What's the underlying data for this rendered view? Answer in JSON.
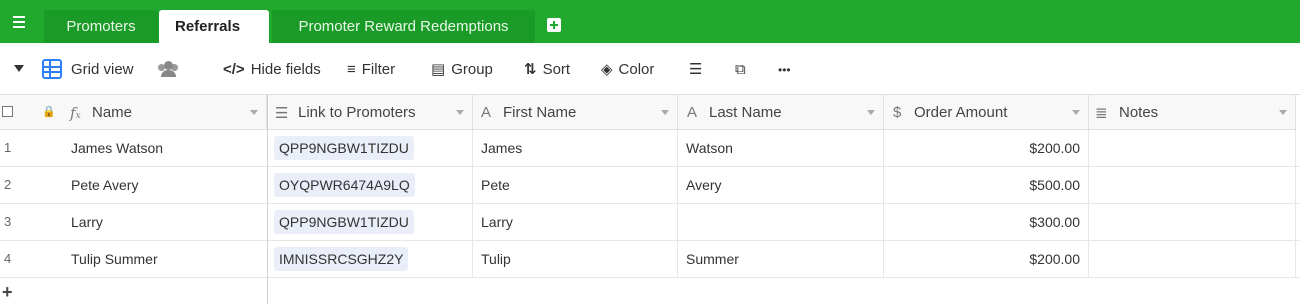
{
  "tabs": [
    {
      "label": "Promoters",
      "active": false
    },
    {
      "label": "Referrals",
      "active": true
    },
    {
      "label": "Promoter Reward Redemptions",
      "active": false
    }
  ],
  "toolbar": {
    "view_name": "Grid view",
    "hide_fields": "Hide fields",
    "filter": "Filter",
    "group": "Group",
    "sort": "Sort",
    "color": "Color",
    "more": "•••"
  },
  "columns": [
    {
      "label": "Name",
      "icon": "formula-icon"
    },
    {
      "label": "Link to Promoters",
      "icon": "link-icon"
    },
    {
      "label": "First Name",
      "icon": "text-icon"
    },
    {
      "label": "Last Name",
      "icon": "text-icon"
    },
    {
      "label": "Order Amount",
      "icon": "currency-icon"
    },
    {
      "label": "Notes",
      "icon": "long-text-icon"
    }
  ],
  "rows": [
    {
      "num": "1",
      "name": "James Watson",
      "link": "QPP9NGBW1TIZDU",
      "first": "James",
      "last": "Watson",
      "amount": "$200.00",
      "notes": ""
    },
    {
      "num": "2",
      "name": "Pete Avery",
      "link": "OYQPWR6474A9LQ",
      "first": "Pete",
      "last": "Avery",
      "amount": "$500.00",
      "notes": ""
    },
    {
      "num": "3",
      "name": "Larry",
      "link": "QPP9NGBW1TIZDU",
      "first": "Larry",
      "last": "",
      "amount": "$300.00",
      "notes": ""
    },
    {
      "num": "4",
      "name": "Tulip Summer",
      "link": "IMNISSRCSGHZ2Y",
      "first": "Tulip",
      "last": "Summer",
      "amount": "$200.00",
      "notes": ""
    }
  ],
  "add_row": "+",
  "colors": {
    "brand": "#20a92d",
    "accent": "#2d7ff9",
    "chip": "#e9eef8"
  }
}
